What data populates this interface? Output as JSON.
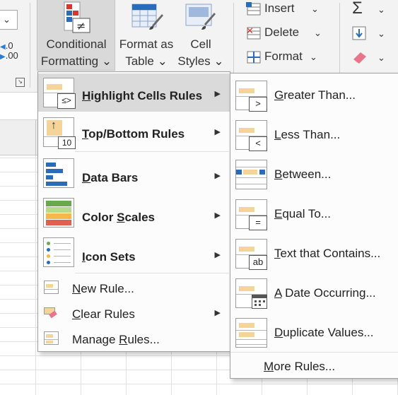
{
  "ribbon": {
    "number_group": {
      "increase_decimal": ".0",
      "decrease_decimal": ".00",
      "launcher": "dialog-launcher-icon"
    },
    "conditional_formatting": {
      "line1": "Conditional",
      "line2": "Formatting",
      "chevron": "⌄"
    },
    "format_as_table": {
      "line1": "Format as",
      "line2": "Table",
      "chevron": "⌄"
    },
    "cell_styles": {
      "line1": "Cell",
      "line2": "Styles",
      "chevron": "⌄"
    },
    "cells": {
      "insert": "Insert",
      "delete": "Delete",
      "format": "Format"
    },
    "editing": {
      "autosum_symbol": "Σ"
    }
  },
  "conditional_menu": {
    "highlight": {
      "prefix": "",
      "accel": "H",
      "rest": "ighlight Cells Rules"
    },
    "topbottom": {
      "accel": "T",
      "rest": "op/Bottom Rules"
    },
    "databars": {
      "prefix": "",
      "accel": "D",
      "rest": "ata Bars"
    },
    "colorscales": {
      "prefix": "Color ",
      "accel": "S",
      "rest": "cales"
    },
    "iconsets": {
      "accel": "I",
      "rest": "con Sets"
    },
    "newrule": {
      "accel": "N",
      "rest": "ew Rule..."
    },
    "clearrules": {
      "accel": "C",
      "rest": "lear Rules"
    },
    "managerules": {
      "prefix": "Manage ",
      "accel": "R",
      "rest": "ules..."
    },
    "icon_text": {
      "topbottom_number": "10",
      "highlight_symbol": "≤>"
    }
  },
  "highlight_submenu": {
    "greater": {
      "accel": "G",
      "rest": "reater Than...",
      "symbol": ">"
    },
    "less": {
      "accel": "L",
      "rest": "ess Than...",
      "symbol": "<"
    },
    "between": {
      "accel": "B",
      "rest": "etween..."
    },
    "equal": {
      "accel": "E",
      "rest": "qual To...",
      "symbol": "="
    },
    "contains": {
      "accel": "T",
      "rest": "ext that Contains...",
      "symbol": "ab"
    },
    "date": {
      "accel": "A",
      "rest": " Date Occurring..."
    },
    "duplicate": {
      "accel": "D",
      "rest": "uplicate Values..."
    },
    "more": {
      "prefix": "",
      "accel": "M",
      "rest": "ore Rules..."
    }
  },
  "colors": {
    "highlight_fill": "#f5d49a",
    "accent_blue": "#2b6cb8",
    "menu_highlight": "#dadada",
    "red": "#d33a2c"
  }
}
